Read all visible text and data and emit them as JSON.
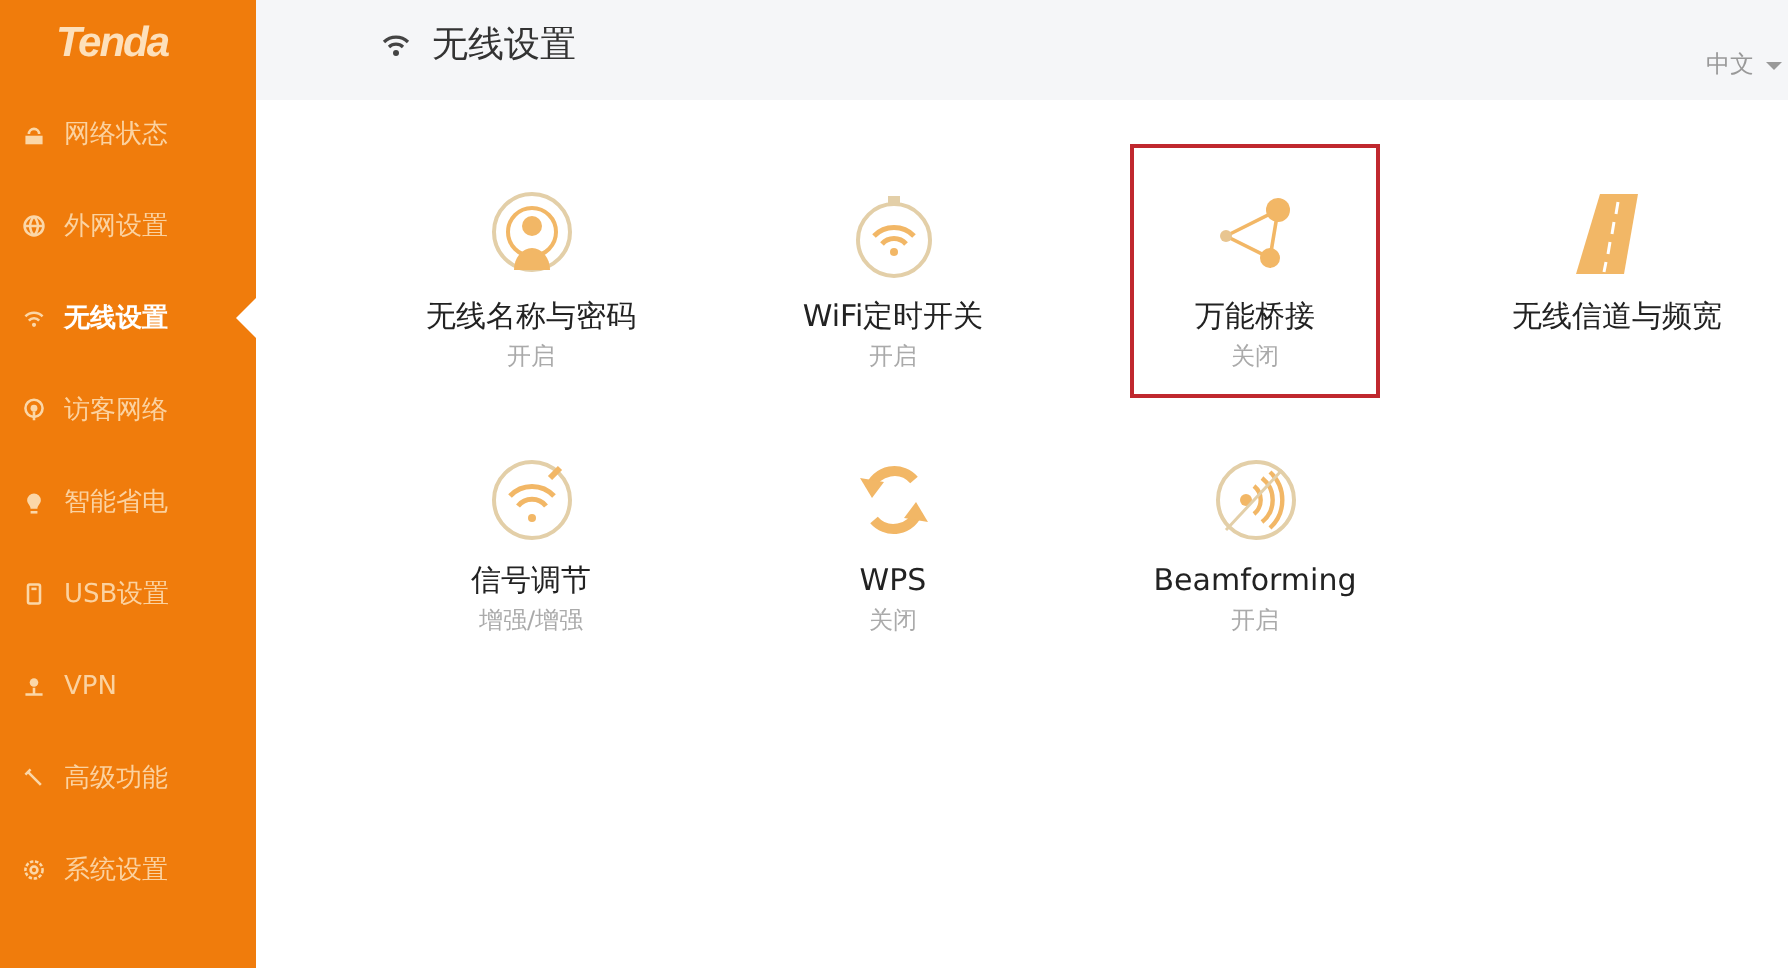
{
  "logo": "Tenda",
  "sidebar": {
    "items": [
      {
        "label": "网络状态",
        "selected": false
      },
      {
        "label": "外网设置",
        "selected": false
      },
      {
        "label": "无线设置",
        "selected": true
      },
      {
        "label": "访客网络",
        "selected": false
      },
      {
        "label": "智能省电",
        "selected": false
      },
      {
        "label": "USB设置",
        "selected": false
      },
      {
        "label": "VPN",
        "selected": false
      },
      {
        "label": "高级功能",
        "selected": false
      },
      {
        "label": "系统设置",
        "selected": false
      }
    ]
  },
  "header": {
    "title": "无线设置",
    "language": "中文"
  },
  "tiles": [
    {
      "label": "无线名称与密码",
      "status": "开启",
      "highlighted": false
    },
    {
      "label": "WiFi定时开关",
      "status": "开启",
      "highlighted": false
    },
    {
      "label": "万能桥接",
      "status": "关闭",
      "highlighted": true
    },
    {
      "label": "无线信道与频宽",
      "highlighted": false
    },
    {
      "label": "信号调节",
      "status": "增强/增强",
      "highlighted": false
    },
    {
      "label": "WPS",
      "status": "关闭",
      "highlighted": false
    },
    {
      "label": "Beamforming",
      "status": "开启",
      "highlighted": false
    }
  ]
}
